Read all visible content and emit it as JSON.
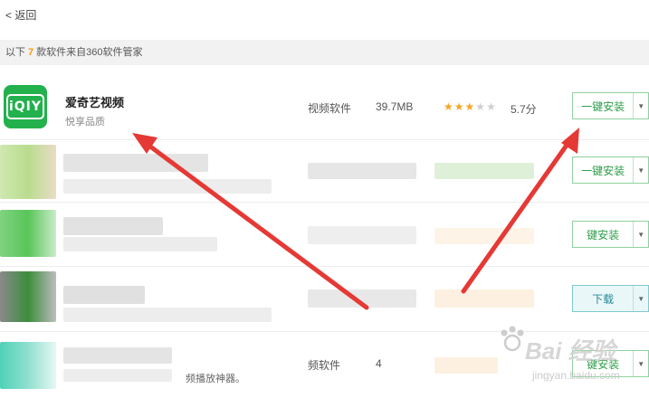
{
  "nav": {
    "back_label": "< 返回"
  },
  "notice": {
    "lead": "以下",
    "count": "7",
    "trail": "款软件来自360软件管家"
  },
  "featured_app": {
    "name": "爱奇艺视频",
    "subtitle": "悦享品质",
    "category": "视频软件",
    "size": "39.7MB",
    "rating_stars": 3,
    "rating_max": 5,
    "score": "5.7分",
    "install_label": "一键安装",
    "logo_text": "iQIY"
  },
  "rows": [
    {
      "button_label": "一键安装"
    },
    {
      "button_label": "键安装"
    },
    {
      "button_label": "下载"
    },
    {
      "button_label": "键安装",
      "partial_category": "频软件",
      "partial_size": "4",
      "partial_note": "频播放神器。"
    }
  ],
  "watermark": {
    "brand": "Bai 经验",
    "url": "jingyan.baidu.com"
  },
  "colors": {
    "accent_green": "#2e9e4a",
    "star": "#f5a623",
    "count_orange": "#f39c12",
    "arrow_red": "#e53935"
  }
}
